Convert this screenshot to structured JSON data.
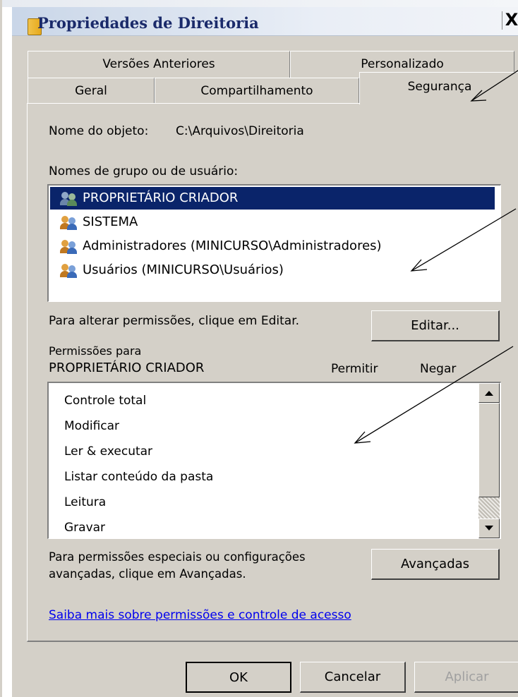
{
  "window": {
    "title": "Propriedades de Direitoria",
    "close_label": "X"
  },
  "tabs": {
    "row1": [
      "Versões Anteriores",
      "Personalizado"
    ],
    "row2": [
      "Geral",
      "Compartilhamento",
      "Segurança"
    ],
    "active": "Segurança"
  },
  "security": {
    "object_name_label": "Nome do objeto:",
    "object_name_value": "C:\\Arquivos\\Direitoria",
    "groups_label": "Nomes de grupo ou de usuário:",
    "groups": [
      {
        "name": "PROPRIETÁRIO CRIADOR",
        "selected": true
      },
      {
        "name": "SISTEMA",
        "selected": false
      },
      {
        "name": "Administradores (MINICURSO\\Administradores)",
        "selected": false
      },
      {
        "name": "Usuários (MINICURSO\\Usuários)",
        "selected": false
      }
    ],
    "edit_hint": "Para alterar permissões, clique em Editar.",
    "edit_button": "Editar...",
    "permissions_for_label": "Permissões para",
    "permissions_for_value": "PROPRIETÁRIO CRIADOR",
    "allow_header": "Permitir",
    "deny_header": "Negar",
    "permissions": [
      "Controle total",
      "Modificar",
      "Ler & executar",
      "Listar conteúdo da pasta",
      "Leitura",
      "Gravar"
    ],
    "advanced_hint_line1": "Para permissões especiais ou configurações",
    "advanced_hint_line2": "avançadas, clique em Avançadas.",
    "advanced_button": "Avançadas",
    "learn_more_link": "Saiba mais sobre permissões e controle de acesso"
  },
  "footer": {
    "ok": "OK",
    "cancel": "Cancelar",
    "apply": "Aplicar"
  },
  "colors": {
    "selection": "#0a246a",
    "dialog_bg": "#d4d0c8",
    "link": "#0000ee"
  },
  "icons": [
    "folder-icon",
    "users-group-icon",
    "scroll-up-icon",
    "scroll-down-icon"
  ]
}
